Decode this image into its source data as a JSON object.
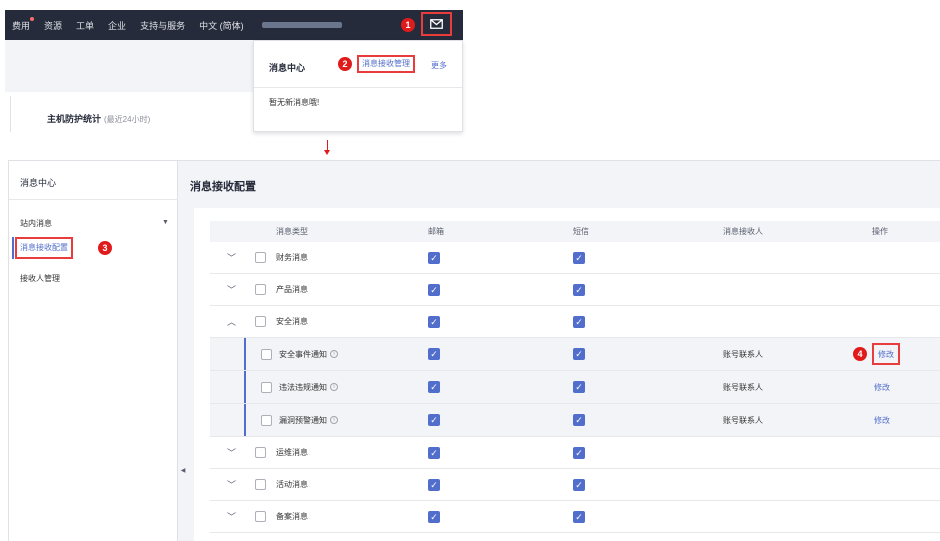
{
  "topnav": {
    "items": [
      "费用",
      "资源",
      "工单",
      "企业",
      "支持与服务",
      "中文 (简体)"
    ],
    "mail_icon": "mail-icon"
  },
  "callouts": [
    "1",
    "2",
    "3",
    "4"
  ],
  "background": {
    "stat_title": "主机防护统计",
    "stat_subtitle": "(最近24小时)"
  },
  "message_dropdown": {
    "title": "消息中心",
    "manage_link": "消息接收管理",
    "more_link": "更多",
    "empty_text": "暂无新消息哦!"
  },
  "sidebar": {
    "title": "消息中心",
    "group": "站内消息",
    "active_item": "消息接收配置",
    "recipients_item": "接收人管理"
  },
  "main": {
    "title": "消息接收配置",
    "columns": [
      "消息类型",
      "邮箱",
      "短信",
      "消息接收人",
      "操作"
    ],
    "rows": [
      {
        "type": "财务消息",
        "expanded": false
      },
      {
        "type": "产品消息",
        "expanded": false
      },
      {
        "type": "安全消息",
        "expanded": true
      },
      {
        "type": "安全事件通知",
        "sub": true,
        "recipient": "账号联系人",
        "action": "修改"
      },
      {
        "type": "违法违规通知",
        "sub": true,
        "recipient": "账号联系人",
        "action": "修改"
      },
      {
        "type": "漏洞预警通知",
        "sub": true,
        "recipient": "账号联系人",
        "action": "修改"
      },
      {
        "type": "运维消息",
        "expanded": false
      },
      {
        "type": "活动消息",
        "expanded": false
      },
      {
        "type": "备案消息",
        "expanded": false
      }
    ]
  },
  "colors": {
    "accent": "#526ecc",
    "highlight": "#e93c3c",
    "nav_bg": "#252b3a"
  }
}
